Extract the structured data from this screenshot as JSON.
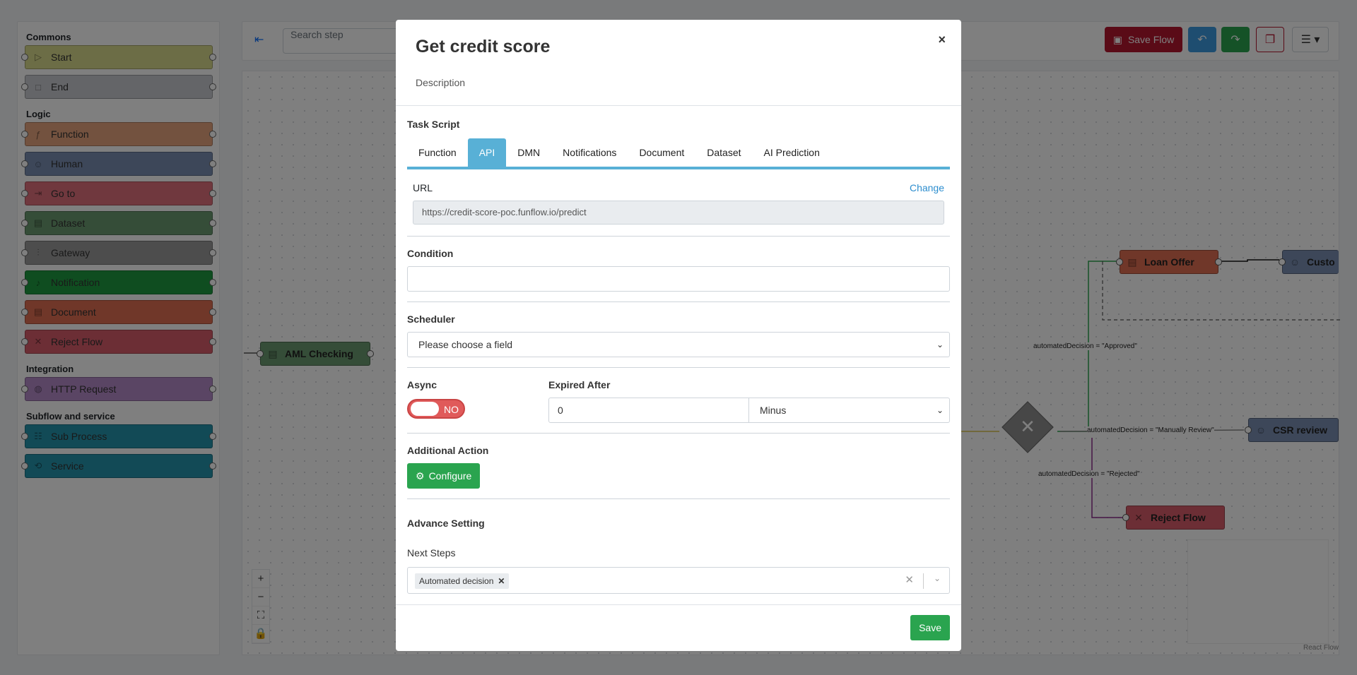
{
  "sidebar": {
    "groups": [
      {
        "title": "Commons",
        "items": [
          {
            "label": "Start",
            "icon": "play-icon",
            "color": "#d9da8c"
          },
          {
            "label": "End",
            "icon": "square-icon",
            "color": "#c9cbd1"
          }
        ]
      },
      {
        "title": "Logic",
        "items": [
          {
            "label": "Function",
            "icon": "function-icon",
            "color": "#e7a57e"
          },
          {
            "label": "Human",
            "icon": "users-icon",
            "color": "#7a8fb3"
          },
          {
            "label": "Go to",
            "icon": "goto-icon",
            "color": "#e0707c"
          },
          {
            "label": "Dataset",
            "icon": "file-icon",
            "color": "#6b9a70"
          },
          {
            "label": "Gateway",
            "icon": "sliders-icon",
            "color": "#9a9a9a"
          },
          {
            "label": "Notification",
            "icon": "bell-icon",
            "color": "#1f9b40"
          },
          {
            "label": "Document",
            "icon": "document-icon",
            "color": "#e16f52"
          },
          {
            "label": "Reject Flow",
            "icon": "x-icon",
            "color": "#d95c6a"
          }
        ]
      },
      {
        "title": "Integration",
        "items": [
          {
            "label": "HTTP Request",
            "icon": "globe-icon",
            "color": "#b58ac9"
          }
        ]
      },
      {
        "title": "Subflow and service",
        "items": [
          {
            "label": "Sub Process",
            "icon": "sitemap-icon",
            "color": "#2594ad"
          },
          {
            "label": "Service",
            "icon": "sync-icon",
            "color": "#2594ad"
          }
        ]
      }
    ]
  },
  "topbar": {
    "search_placeholder": "Search step",
    "save_flow_label": "Save Flow",
    "colors": {
      "save": "#b5162f",
      "undo": "#3d9be0",
      "redo": "#2aa44f"
    }
  },
  "canvas": {
    "nodes": {
      "aml": "AML Checking",
      "loan_offer": "Loan Offer",
      "customer": "Custo",
      "csr_review": "CSR review",
      "reject_flow": "Reject Flow"
    },
    "edges": {
      "approved": "automatedDecision = \"Approved\"",
      "manual": "automatedDecision = \"Manually Review\"",
      "rejected": "automatedDecision = \"Rejected\""
    },
    "zoom_controls": [
      "+",
      "−",
      "⛶",
      "🔒"
    ],
    "attribution": "React Flow"
  },
  "modal": {
    "title": "Get credit score",
    "description": "Description",
    "close": "×",
    "task_script": {
      "label": "Task Script",
      "tabs": [
        "Function",
        "API",
        "DMN",
        "Notifications",
        "Document",
        "Dataset",
        "AI Prediction"
      ],
      "active_tab": "API",
      "url_label": "URL",
      "change_label": "Change",
      "url_value": "https://credit-score-poc.funflow.io/predict"
    },
    "condition": {
      "label": "Condition",
      "value": ""
    },
    "scheduler": {
      "label": "Scheduler",
      "value": "Please choose a field"
    },
    "async": {
      "label": "Async",
      "toggle_label": "NO"
    },
    "expired_after": {
      "label": "Expired After",
      "value": "0",
      "unit": "Minus"
    },
    "additional_action": {
      "label": "Additional Action",
      "button": "Configure"
    },
    "advance_setting": {
      "label": "Advance Setting",
      "next_steps_label": "Next Steps",
      "next_steps_chip": "Automated decision"
    },
    "save_label": "Save"
  }
}
